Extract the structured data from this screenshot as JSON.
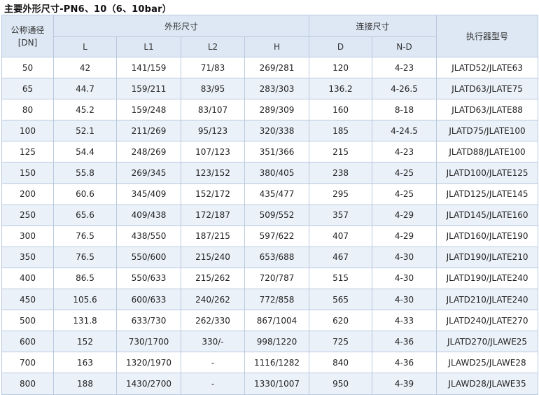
{
  "title": "主要外形尺寸-PN6、10（6、10bar）",
  "header": {
    "dn_line1": "公称通径",
    "dn_line2": "[DN]",
    "outline_group": "外形尺寸",
    "connect_group": "连接尺寸",
    "actuator": "执行器型号",
    "columns": [
      "L",
      "L1",
      "L2",
      "H",
      "D",
      "N-D"
    ]
  },
  "rows": [
    [
      "50",
      "42",
      "141/159",
      "71/83",
      "269/281",
      "120",
      "4-23",
      "JLATD52/JLATE63"
    ],
    [
      "65",
      "44.7",
      "159/211",
      "83/95",
      "283/303",
      "136.2",
      "4-26.5",
      "JLATD63/JLATE75"
    ],
    [
      "80",
      "45.2",
      "159/248",
      "83/107",
      "289/309",
      "160",
      "8-18",
      "JLATD63/JLATE88"
    ],
    [
      "100",
      "52.1",
      "211/269",
      "95/123",
      "320/338",
      "185",
      "4-24.5",
      "JLATD75/JLATE100"
    ],
    [
      "125",
      "54.4",
      "248/269",
      "107/123",
      "351/366",
      "215",
      "4-23",
      "JLATD88/JLATE100"
    ],
    [
      "150",
      "55.8",
      "269/345",
      "123/152",
      "380/405",
      "238",
      "4-25",
      "JLATD100/JLATE125"
    ],
    [
      "200",
      "60.6",
      "345/409",
      "152/172",
      "435/477",
      "295",
      "4-25",
      "JLATD125/JLATE145"
    ],
    [
      "250",
      "65.6",
      "409/438",
      "172/187",
      "509/552",
      "357",
      "4-29",
      "JLATD145/JLATE160"
    ],
    [
      "300",
      "76.5",
      "438/550",
      "187/215",
      "597/622",
      "407",
      "4-29",
      "JLATD160/JLATE190"
    ],
    [
      "350",
      "76.5",
      "550/600",
      "215/240",
      "653/688",
      "467",
      "4-30",
      "JLATD190/JLATE210"
    ],
    [
      "400",
      "86.5",
      "550/633",
      "215/262",
      "720/787",
      "515",
      "4-30",
      "JLATD190/JLATE240"
    ],
    [
      "450",
      "105.6",
      "600/633",
      "240/262",
      "772/858",
      "565",
      "4-30",
      "JLATD210/JLATE240"
    ],
    [
      "500",
      "131.8",
      "633/730",
      "262/330",
      "867/1004",
      "620",
      "4-33",
      "JLATD240/JLATE270"
    ],
    [
      "600",
      "152",
      "730/1700",
      "330/-",
      "998/1220",
      "725",
      "4-36",
      "JLATD270/JLAWE25"
    ],
    [
      "700",
      "163",
      "1320/1970",
      "-",
      "1116/1282",
      "840",
      "4-36",
      "JLAWD25/JLAWE28"
    ],
    [
      "800",
      "188",
      "1430/2700",
      "-",
      "1330/1007",
      "950",
      "4-39",
      "JLAWD28/JLAWE35"
    ]
  ]
}
